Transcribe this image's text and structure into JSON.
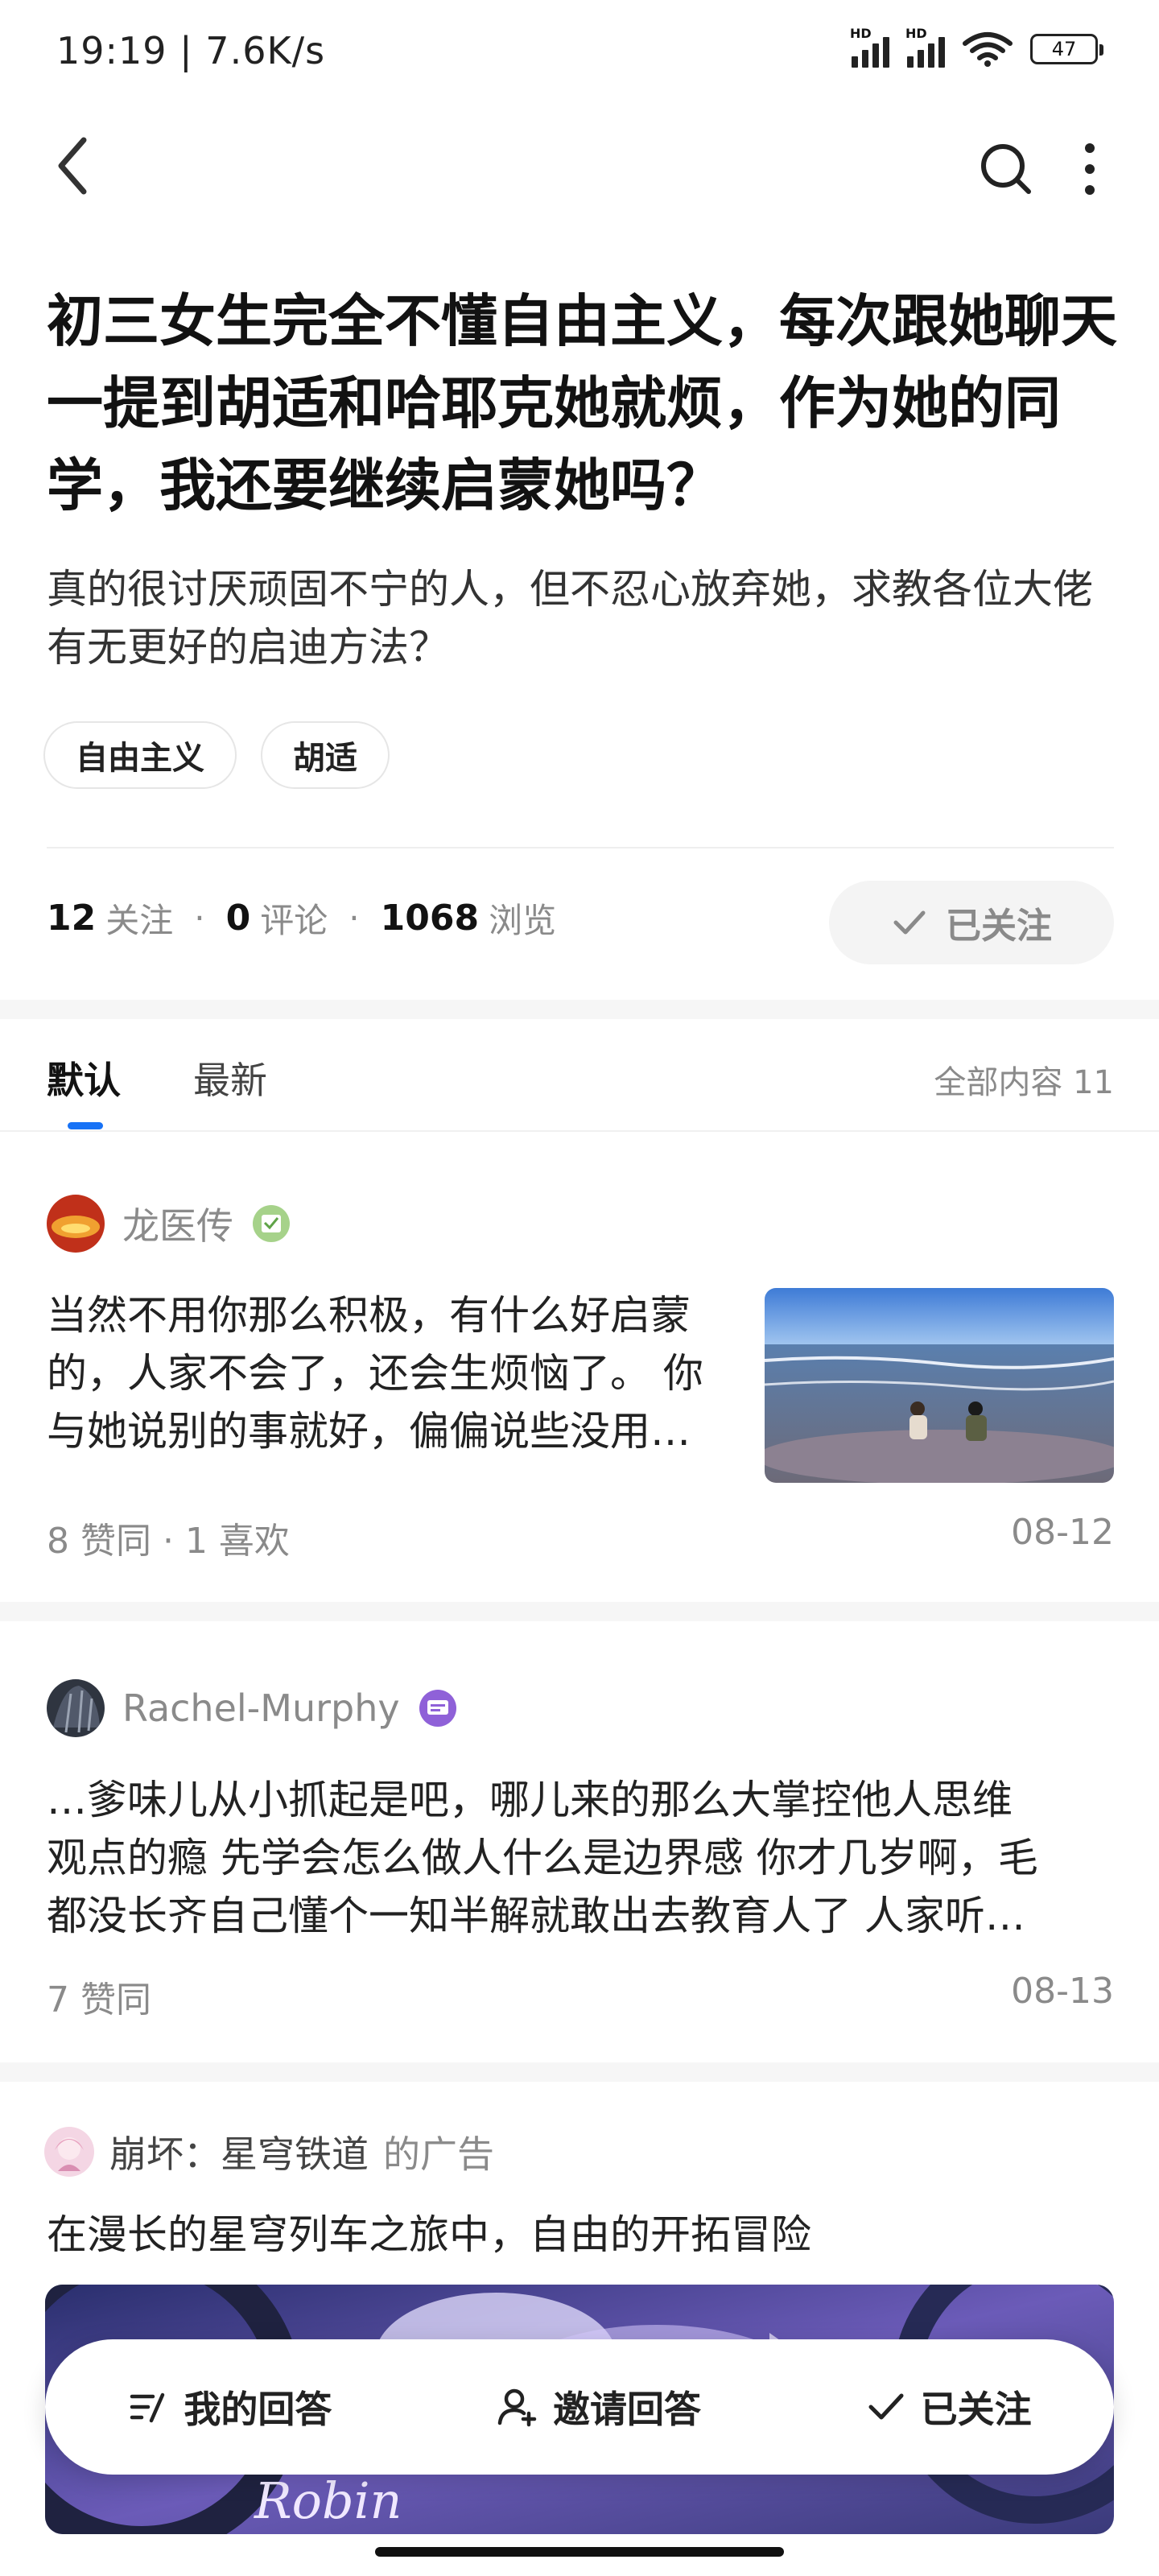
{
  "status_bar": {
    "time": "19:19 | 7.6K/s",
    "battery": "47"
  },
  "question": {
    "title": "初三女生完全不懂自由主义，每次跟她聊天一提到胡适和哈耶克她就烦，作为她的同学，我还要继续启蒙她吗？",
    "description": "真的很讨厌顽固不宁的人，但不忍心放弃她，求教各位大佬有无更好的启迪方法？",
    "tags": [
      "自由主义",
      "胡适"
    ],
    "followers_count": "12",
    "followers_label": "关注",
    "comments_count": "0",
    "comments_label": "评论",
    "views_count": "1068",
    "views_label": "浏览",
    "dot": "·",
    "follow_state": "已关注"
  },
  "tabs": {
    "default": "默认",
    "latest": "最新",
    "all_content": "全部内容 11"
  },
  "answers": [
    {
      "author": "龙医传",
      "text_lines": [
        "当然不用你那么积极，有什么好启蒙",
        "的，人家不会了，还会生烦恼了。 你",
        "与她说别的事就好，偏偏说些没用…"
      ],
      "meta": "8  赞同 · 1  喜欢",
      "date": "08-12"
    },
    {
      "author": "Rachel-Murphy",
      "text_lines": [
        "…爹味儿从小抓起是吧，哪儿来的那么大掌控他人思维",
        "观点的瘾 先学会怎么做人什么是边界感 你才几岁啊，毛",
        "都没长齐自己懂个一知半解就敢出去教育人了 人家听…"
      ],
      "meta": "7  赞同",
      "date": "08-13"
    }
  ],
  "ad": {
    "advertiser": "崩坏：星穹铁道",
    "suffix": "的广告",
    "title": "在漫长的星穹列车之旅中，自由的开拓冒险",
    "image_text": "Robin"
  },
  "bottom_bar": {
    "my_answer": "我的回答",
    "invite": "邀请回答",
    "followed": "已关注"
  },
  "colors": {
    "accent": "#1772f6",
    "muted": "#8a8a8a"
  }
}
